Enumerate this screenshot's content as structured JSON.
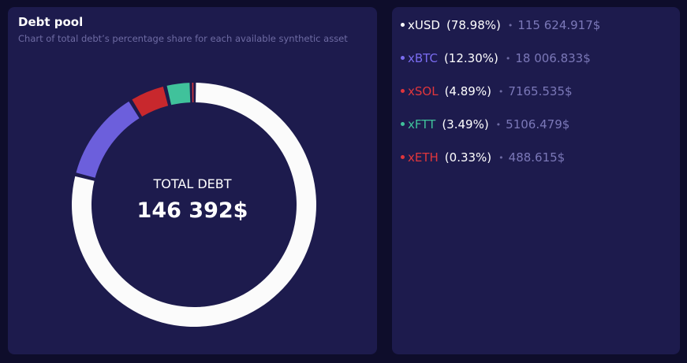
{
  "debt_pool": {
    "title": "Debt pool",
    "subtitle": "Chart of total debt’s percentage share for each available synthetic asset",
    "total_caption": "TOTAL DEBT",
    "total_value": "146 392$"
  },
  "chart_data": {
    "type": "pie",
    "title": "Debt pool",
    "categories": [
      "xUSD",
      "xBTC",
      "xSOL",
      "xFTT",
      "xETH"
    ],
    "values": [
      78.98,
      12.3,
      4.89,
      3.49,
      0.33
    ],
    "colors": [
      "#fbfbfb",
      "#6c5fdc",
      "#c8282d",
      "#40c29b",
      "#d8363c"
    ]
  },
  "assets": [
    {
      "name": "xUSD",
      "percent": "(78.98%)",
      "value": "115 624.917$",
      "color": "#ffffff"
    },
    {
      "name": "xBTC",
      "percent": "(12.30%)",
      "value": "18 006.833$",
      "color": "#7a6cf0"
    },
    {
      "name": "xSOL",
      "percent": "(4.89%)",
      "value": "7165.535$",
      "color": "#e0363c"
    },
    {
      "name": "xFTT",
      "percent": "(3.49%)",
      "value": "5106.479$",
      "color": "#40c29b"
    },
    {
      "name": "xETH",
      "percent": "(0.33%)",
      "value": "488.615$",
      "color": "#e0363c"
    }
  ],
  "separator": "•"
}
